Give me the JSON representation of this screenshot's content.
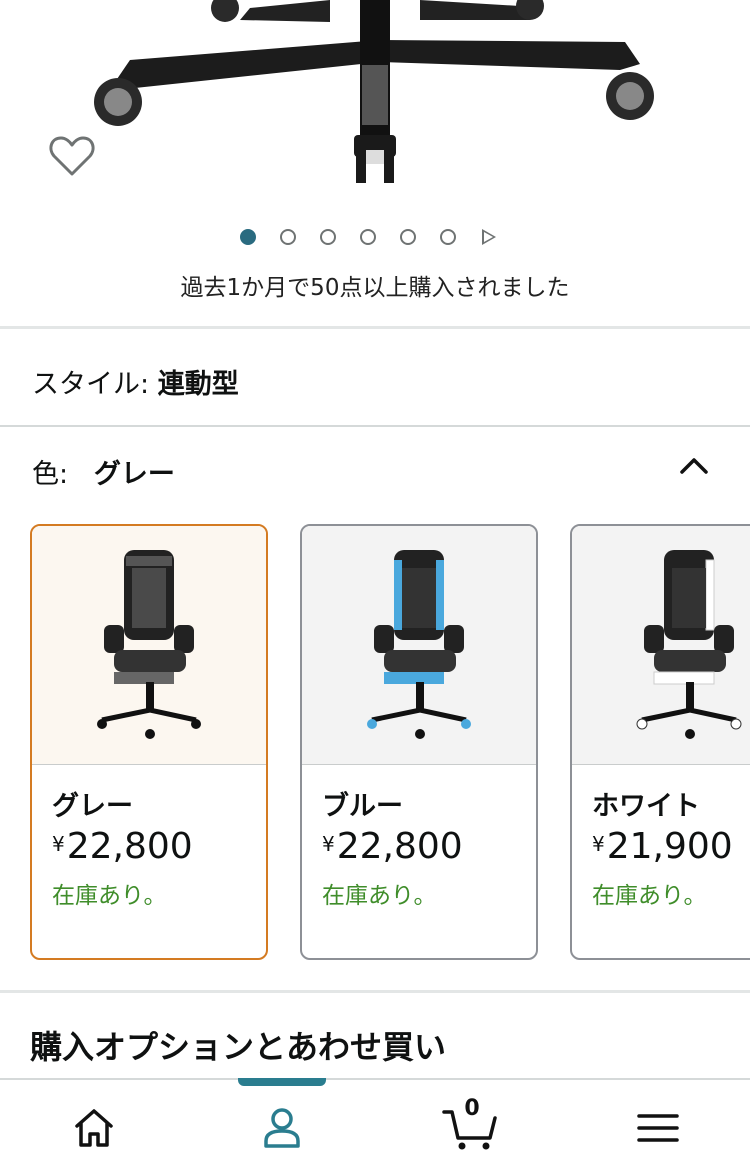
{
  "carousel": {
    "dots_total": 6,
    "active_index": 0,
    "bought_text": "過去1か月で50点以上購入されました"
  },
  "style": {
    "label": "スタイル:",
    "value": "連動型"
  },
  "color": {
    "label": "色:",
    "value": "グレー"
  },
  "variants": [
    {
      "name": "グレー",
      "currency": "¥",
      "price": "22,800",
      "stock": "在庫あり。",
      "selected": true,
      "accent": "#555555"
    },
    {
      "name": "ブルー",
      "currency": "¥",
      "price": "22,800",
      "stock": "在庫あり。",
      "selected": false,
      "accent": "#4aa8dd"
    },
    {
      "name": "ホワイト",
      "currency": "¥",
      "price": "21,900",
      "stock": "在庫あり。",
      "selected": false,
      "accent": "#ffffff"
    }
  ],
  "section": {
    "title": "購入オプションとあわせ買い"
  },
  "tabbar": {
    "items": [
      "home-icon",
      "account-icon",
      "cart-icon",
      "menu-icon"
    ],
    "cart_count": "0",
    "active": "account-icon"
  },
  "colors": {
    "selected_border": "#d47b22",
    "stock_green": "#3f8d2a",
    "active_dot": "#2a6b80"
  }
}
